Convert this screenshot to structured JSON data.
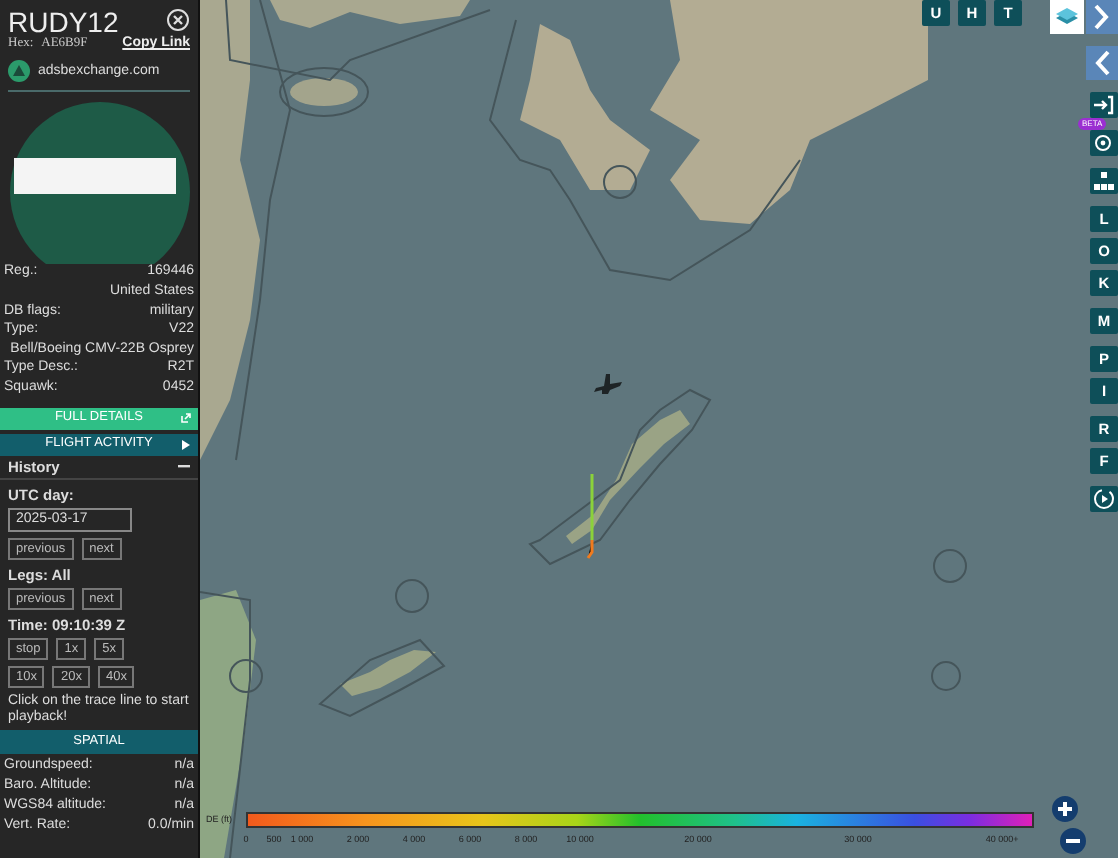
{
  "panel": {
    "callsign": "RUDY12",
    "hex_label": "Hex:",
    "hex": "AE6B9F",
    "copy_link": "Copy Link",
    "site": "adsbexchange.com",
    "details": [
      {
        "label": "Reg.:",
        "value": "169446"
      },
      {
        "value": "United States"
      },
      {
        "label": "DB flags:",
        "value": "military"
      },
      {
        "label": "Type:",
        "value": "V22"
      },
      {
        "value": "Bell/Boeing CMV-22B Osprey"
      },
      {
        "label": "Type Desc.:",
        "value": "R2T"
      },
      {
        "label": "Squawk:",
        "value": "0452"
      }
    ],
    "full_details": "FULL DETAILS",
    "flight_activity": "FLIGHT ACTIVITY",
    "history": {
      "title": "History",
      "expanded": true,
      "utc_day_label": "UTC day:",
      "utc_day": "2025-03-17",
      "day_buttons": [
        "previous",
        "next"
      ],
      "legs_label": "Legs: All",
      "leg_buttons": [
        "previous",
        "next"
      ],
      "time": "Time: 09:10:39 Z",
      "speed_rows": [
        [
          "stop",
          "1x",
          "5x"
        ],
        [
          "10x",
          "20x",
          "40x"
        ]
      ],
      "hint": "Click on the trace line to start playback!"
    },
    "spatial": {
      "title": "SPATIAL",
      "rows": [
        {
          "label": "Groundspeed:",
          "value": "n/a"
        },
        {
          "label": "Baro. Altitude:",
          "value": "n/a"
        },
        {
          "label": "WGS84 altitude:",
          "value": "n/a"
        },
        {
          "label": "Vert. Rate:",
          "value": "0.0/min"
        }
      ]
    }
  },
  "map": {
    "top_buttons": [
      "U",
      "H",
      "T"
    ],
    "side_groups": [
      [
        {
          "kind": "expand"
        }
      ],
      [
        {
          "kind": "collapse"
        }
      ],
      [
        {
          "kind": "login",
          "badge": "BETA"
        }
      ],
      [
        {
          "kind": "settings"
        }
      ],
      [
        {
          "kind": "hierarchy"
        }
      ],
      [
        {
          "kind": "letter",
          "label": "L"
        },
        {
          "kind": "letter",
          "label": "O"
        },
        {
          "kind": "letter",
          "label": "K"
        }
      ],
      [
        {
          "kind": "letter",
          "label": "M"
        }
      ],
      [
        {
          "kind": "letter",
          "label": "P"
        },
        {
          "kind": "letter",
          "label": "I"
        }
      ],
      [
        {
          "kind": "letter",
          "label": "R"
        },
        {
          "kind": "letter",
          "label": "F"
        }
      ],
      [
        {
          "kind": "replay"
        }
      ]
    ],
    "legend": {
      "label": "DE (ft)",
      "ticks": [
        "0",
        "500",
        "1 000",
        "2 000",
        "4 000",
        "6 000",
        "8 000",
        "10 000",
        "20 000",
        "30 000",
        "40 000+"
      ]
    }
  }
}
